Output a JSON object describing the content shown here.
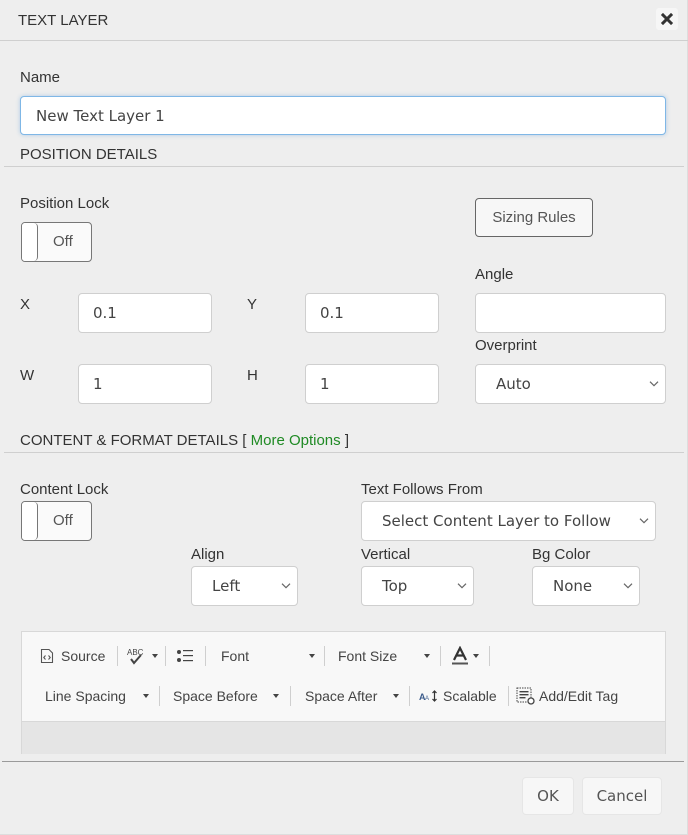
{
  "dialog": {
    "title": "TEXT LAYER",
    "close_icon": "close-icon"
  },
  "name_field": {
    "label": "Name",
    "value": "New Text Layer 1"
  },
  "position_details": {
    "title": "POSITION DETAILS",
    "position_lock": {
      "label": "Position Lock",
      "state": "Off"
    },
    "sizing_rules_label": "Sizing Rules",
    "x": {
      "label": "X",
      "value": "0.1"
    },
    "y": {
      "label": "Y",
      "value": "0.1"
    },
    "w": {
      "label": "W",
      "value": "1"
    },
    "h": {
      "label": "H",
      "value": "1"
    },
    "angle": {
      "label": "Angle",
      "value": ""
    },
    "overprint": {
      "label": "Overprint",
      "selected": "Auto"
    }
  },
  "content_details": {
    "title": "CONTENT & FORMAT DETAILS",
    "bracket_open": "[",
    "more_options": "More Options",
    "bracket_close": "]",
    "link_color": "#1f8a24",
    "content_lock": {
      "label": "Content Lock",
      "state": "Off"
    },
    "text_follows": {
      "label": "Text Follows From",
      "selected": "Select Content Layer to Follow"
    },
    "align": {
      "label": "Align",
      "selected": "Left"
    },
    "vertical": {
      "label": "Vertical",
      "selected": "Top"
    },
    "bg_color": {
      "label": "Bg Color",
      "selected": "None"
    }
  },
  "editor_toolbar": {
    "source": "Source",
    "spellcheck_icon": "spellcheck-icon",
    "bullet_list_icon": "bulleted-list-icon",
    "font": "Font",
    "font_size": "Font Size",
    "text_color_icon": "text-color-icon",
    "line_spacing": "Line Spacing",
    "space_before": "Space Before",
    "space_after": "Space After",
    "scalable": "Scalable",
    "add_edit_tag": "Add/Edit Tag"
  },
  "footer": {
    "ok": "OK",
    "cancel": "Cancel"
  }
}
